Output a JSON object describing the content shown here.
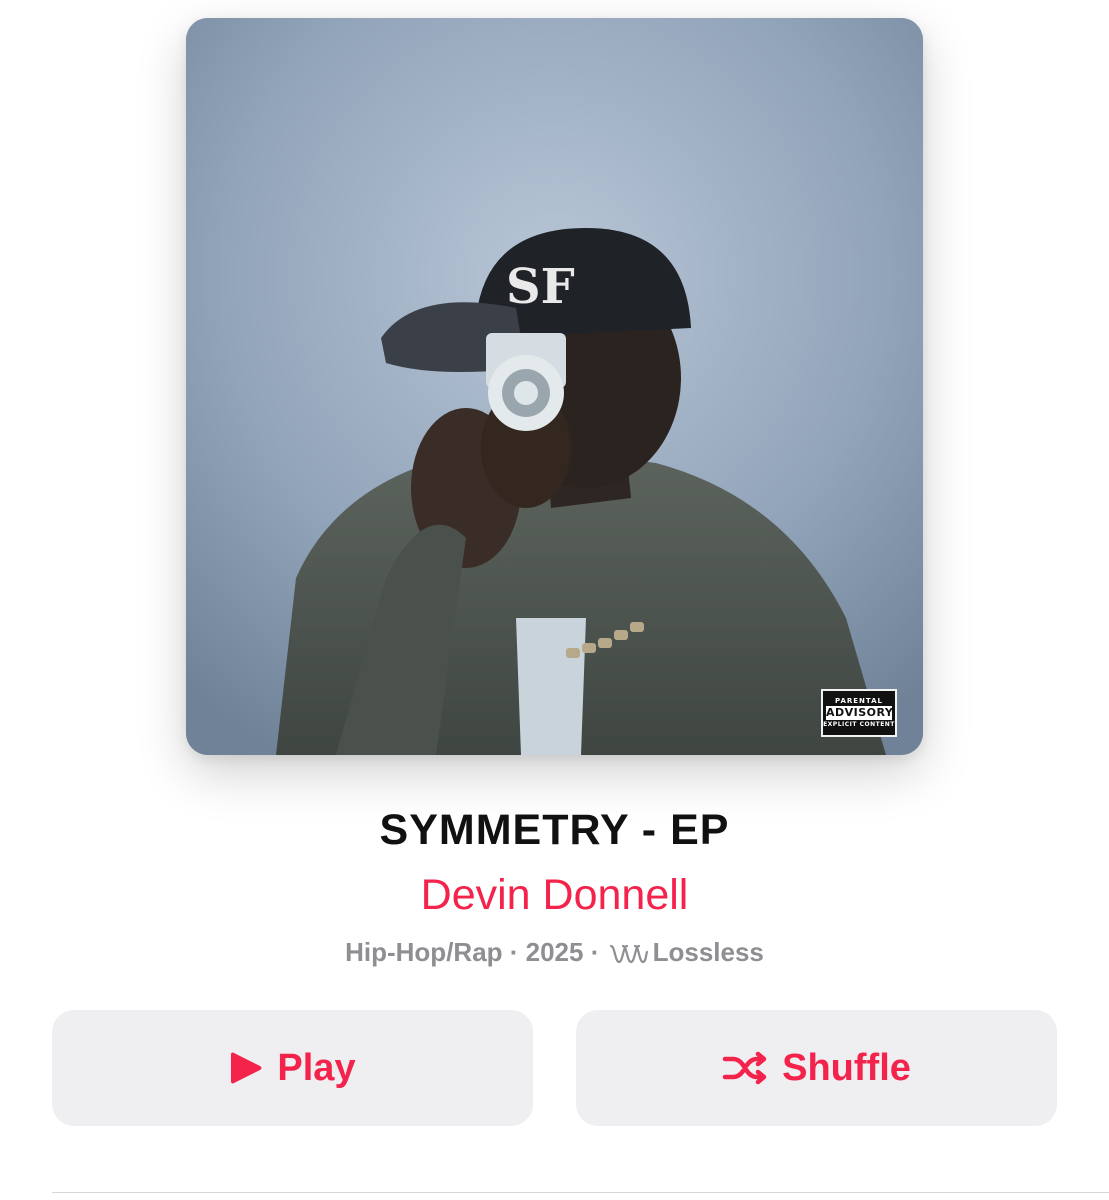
{
  "album": {
    "title": "SYMMETRY - EP",
    "artist": "Devin Donnell",
    "genre": "Hip-Hop/Rap",
    "year": "2025",
    "separator": " · ",
    "quality": "Lossless",
    "quality_icon": "lossless-waveform-icon",
    "advisory": {
      "top": "PARENTAL",
      "middle": "ADVISORY",
      "bottom": "EXPLICIT CONTENT"
    }
  },
  "actions": {
    "play_label": "Play",
    "play_icon": "play-icon",
    "shuffle_label": "Shuffle",
    "shuffle_icon": "shuffle-icon"
  },
  "colors": {
    "accent": "#f3234b",
    "secondary_text": "#8e8e93",
    "button_bg": "#efeff1"
  }
}
